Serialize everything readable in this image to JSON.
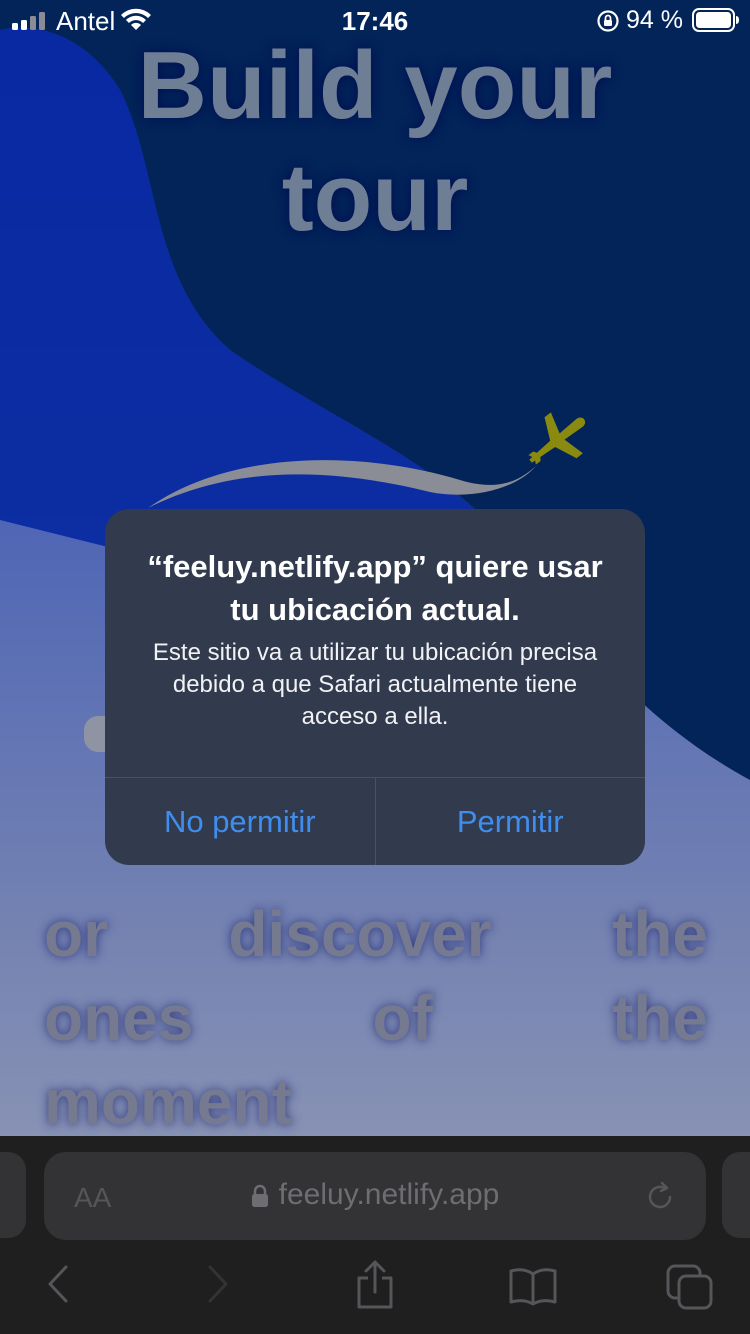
{
  "status_bar": {
    "carrier": "Antel",
    "time": "17:46",
    "battery": "94 %"
  },
  "hero": {
    "title_line1": "Build your",
    "title_line2": "tour"
  },
  "subtitle": {
    "row1": [
      "or",
      "discover",
      "the"
    ],
    "row2": [
      "ones",
      "of",
      "the"
    ],
    "row3": [
      "moment"
    ]
  },
  "alert": {
    "title": "“feeluy.netlify.app” quiere usar tu ubicación actual.",
    "message": "Este sitio va a utilizar tu ubicación precisa debido a que Safari actualmente tiene acceso a ella.",
    "deny_label": "No permitir",
    "allow_label": "Permitir"
  },
  "safari": {
    "text_size_label": "AA",
    "url": "feeluy.netlify.app"
  },
  "icons": {
    "signal": "cellular-signal-icon",
    "wifi": "wifi-icon",
    "rotation_lock": "rotation-lock-icon",
    "battery": "battery-icon",
    "plane": "airplane-icon",
    "padlock": "padlock-icon",
    "reload": "reload-icon",
    "back": "back-chevron-icon",
    "forward": "forward-chevron-icon",
    "share": "share-icon",
    "bookmarks": "bookmarks-icon",
    "tabs": "tabs-icon"
  },
  "colors": {
    "alert_button": "#3f8eed",
    "alert_bg": "#323a4e",
    "plane": "#8a8a10"
  }
}
